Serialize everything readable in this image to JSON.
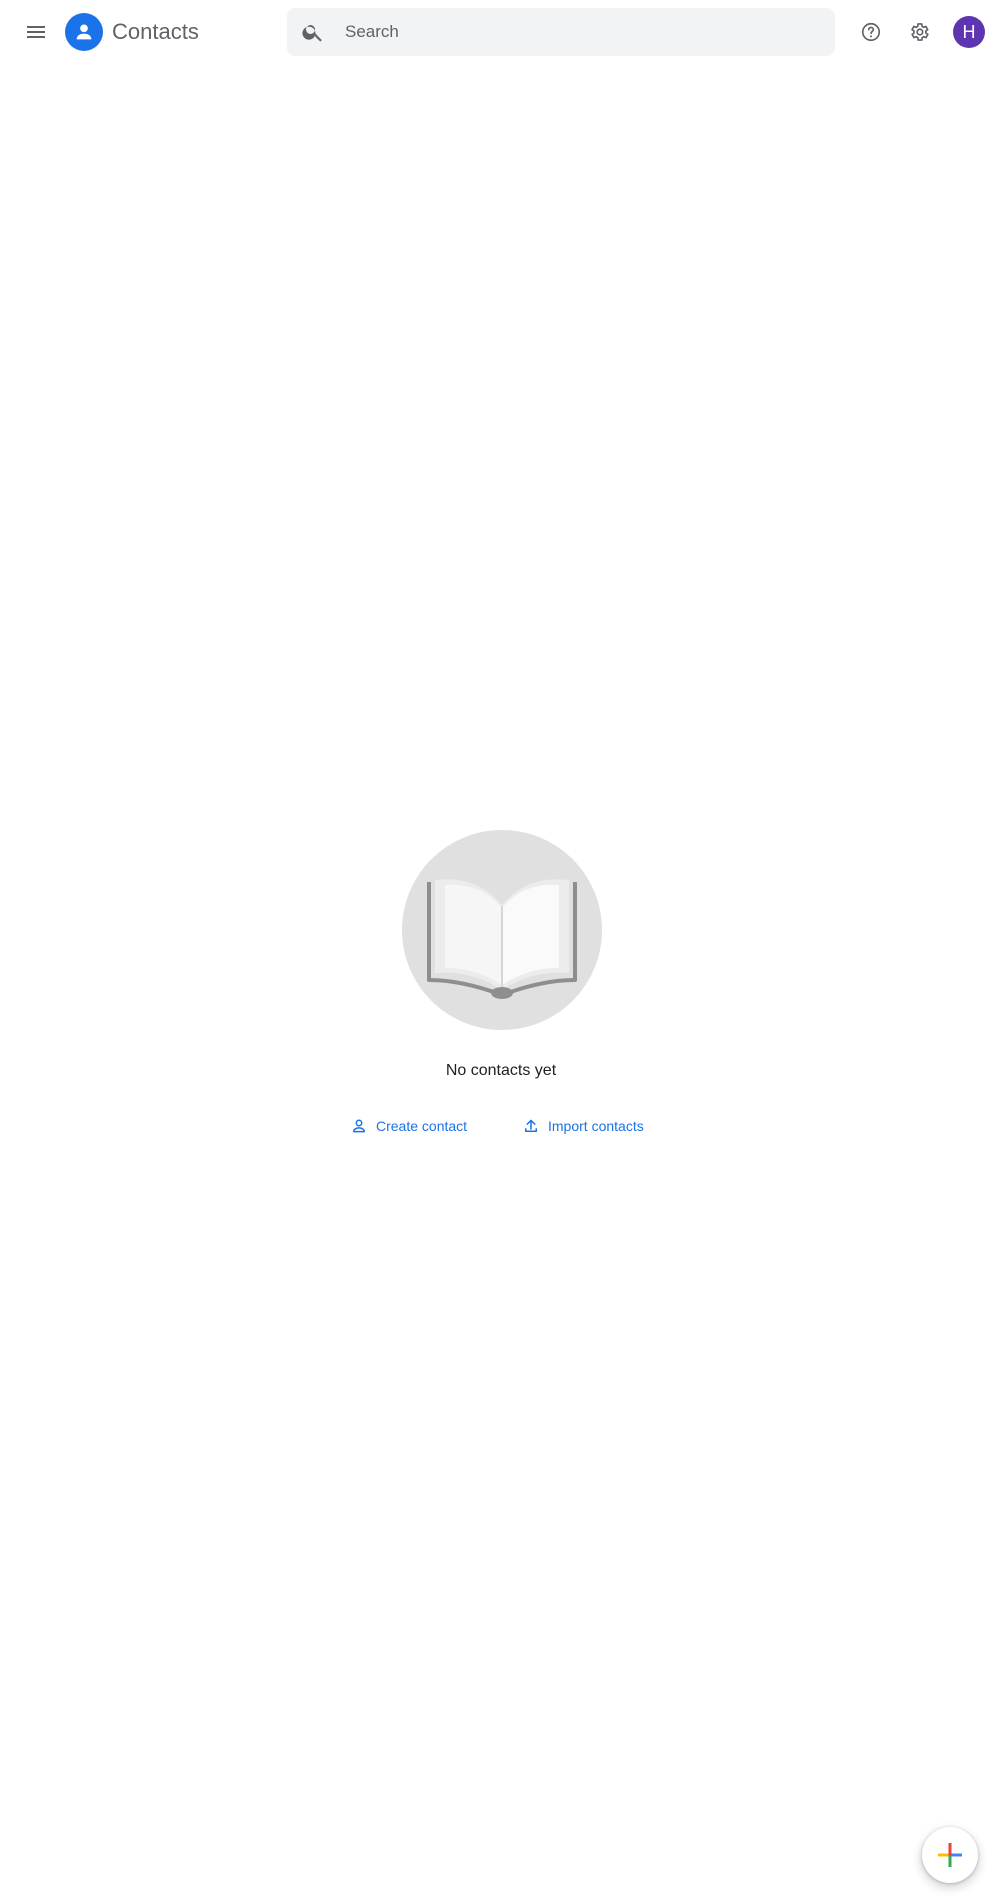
{
  "header": {
    "menu_icon": "menu-icon",
    "logo_icon": "contacts-person-icon",
    "app_title": "Contacts",
    "search": {
      "placeholder": "Search",
      "value": "",
      "icon": "search-icon"
    },
    "help_icon": "help-circle-icon",
    "settings_icon": "gear-icon",
    "avatar_letter": "H",
    "avatar_color": "#5e35b1"
  },
  "main": {
    "illustration_icon": "open-book-icon",
    "empty_message": "No contacts yet",
    "actions": [
      {
        "label": "Create contact",
        "icon": "person-outline-icon"
      },
      {
        "label": "Import contacts",
        "icon": "upload-icon"
      }
    ]
  },
  "fab": {
    "icon": "plus-icon",
    "colors": [
      "#ea4335",
      "#4285f4",
      "#fbbc04",
      "#34a853"
    ]
  },
  "colors": {
    "accent": "#1a73e8",
    "text_secondary": "#5f6368",
    "search_bg": "#f1f3f4"
  }
}
